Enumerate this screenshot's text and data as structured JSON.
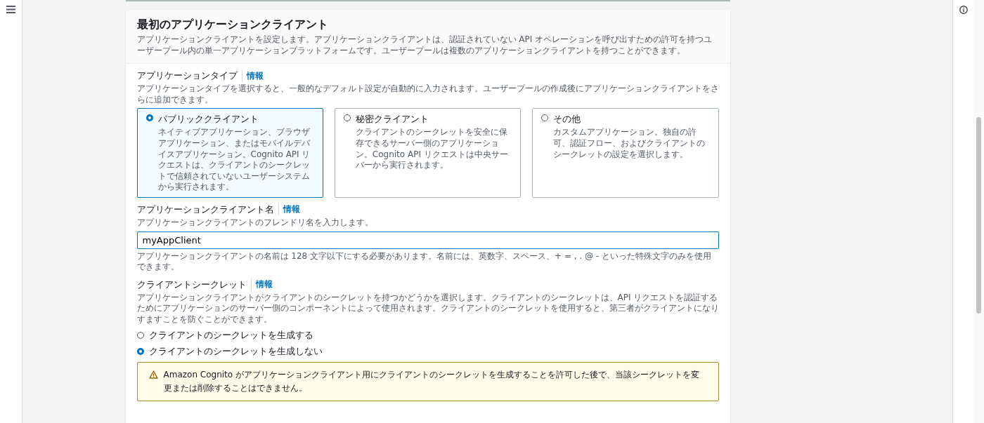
{
  "header": {
    "title": "最初のアプリケーションクライアント",
    "description": "アプリケーションクライアントを設定します。アプリケーションクライアントは、認証されていない API オペレーションを呼び出すための許可を持つユーザープール内の単一アプリケーションプラットフォームです。ユーザープールは複数のアプリケーションクライアントを持つことができます。"
  },
  "app_type": {
    "label": "アプリケーションタイプ",
    "info": "情報",
    "description": "アプリケーションタイプを選択すると、一般的なデフォルト設定が自動的に入力されます。ユーザープールの作成後にアプリケーションクライアントをさらに追加できます。",
    "options": [
      {
        "title": "パブリッククライアント",
        "description": "ネイティブアプリケーション、ブラウザアプリケーション、またはモバイルデバイスアプリケーション。Cognito API リクエストは、クライアントのシークレットで信頼されていないユーザーシステムから実行されます。",
        "selected": true
      },
      {
        "title": "秘密クライアント",
        "description": "クライアントのシークレットを安全に保存できるサーバー側のアプリケーション。Cognito API リクエストは中央サーバーから実行されます。",
        "selected": false
      },
      {
        "title": "その他",
        "description": "カスタムアプリケーション。独自の許可、認証フロー、およびクライアントのシークレットの設定を選択します。",
        "selected": false
      }
    ]
  },
  "client_name": {
    "label": "アプリケーションクライアント名",
    "info": "情報",
    "description": "アプリケーションクライアントのフレンドリ名を入力します。",
    "value": "myAppClient",
    "constraint": "アプリケーションクライアントの名前は 128 文字以下にする必要があります。名前には、英数字、スペース、+ = , . @ - といった特殊文字のみを使用できます。"
  },
  "client_secret": {
    "label": "クライアントシークレット",
    "info": "情報",
    "description": "アプリケーションクライアントがクライアントのシークレットを持つかどうかを選択します。クライアントのシークレットは、API リクエストを認証するためにアプリケーションのサーバー側のコンポーネントによって使用されます。クライアントのシークレットを使用すると、第三者がクライアントになりすますことを防ぐことができます。",
    "options": [
      {
        "label": "クライアントのシークレットを生成する",
        "selected": false
      },
      {
        "label": "クライアントのシークレットを生成しない",
        "selected": true
      }
    ],
    "warning": "Amazon Cognito がアプリケーションクライアント用にクライアントのシークレットを生成することを許可した後で、当該シークレットを変更または削除することはできません。"
  }
}
